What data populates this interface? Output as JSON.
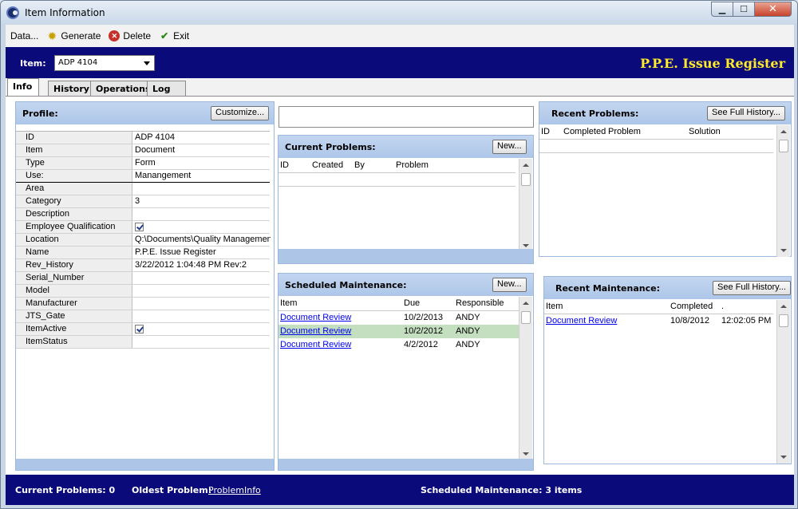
{
  "window": {
    "title": "Item Information"
  },
  "menu": {
    "data": "Data...",
    "generate": "Generate",
    "delete": "Delete",
    "exit": "Exit"
  },
  "header": {
    "item_label": "Item:",
    "item_value": "ADP 4104",
    "app_title": "P.P.E. Issue Register"
  },
  "tabs": [
    "Info",
    "History",
    "Operations",
    "Log"
  ],
  "profile": {
    "title": "Profile:",
    "customize": "Customize...",
    "rows": [
      {
        "k": "ID",
        "v": "ADP 4104"
      },
      {
        "k": "Item",
        "v": "Document"
      },
      {
        "k": "Type",
        "v": "Form"
      },
      {
        "k": "Use:",
        "v": "Manangement"
      },
      {
        "k": "Area",
        "v": ""
      },
      {
        "k": "Category",
        "v": "3"
      },
      {
        "k": "Description",
        "v": ""
      },
      {
        "k": "Employee Qualification",
        "v": "checked"
      },
      {
        "k": "Location",
        "v": "Q:\\Documents\\Quality Managemen"
      },
      {
        "k": "Name",
        "v": "P.P.E. Issue Register"
      },
      {
        "k": "Rev_History",
        "v": "3/22/2012 1:04:48 PM Rev:2"
      },
      {
        "k": "Serial_Number",
        "v": ""
      },
      {
        "k": "Model",
        "v": ""
      },
      {
        "k": "Manufacturer",
        "v": ""
      },
      {
        "k": "JTS_Gate",
        "v": ""
      },
      {
        "k": "ItemActive",
        "v": "checked"
      },
      {
        "k": "ItemStatus",
        "v": ""
      }
    ]
  },
  "search": {
    "value": ""
  },
  "current_problems": {
    "title": "Current Problems:",
    "new": "New...",
    "cols": [
      "ID",
      "Created",
      "By",
      "Problem"
    ]
  },
  "scheduled": {
    "title": "Scheduled Maintenance:",
    "new": "New...",
    "cols": [
      "Item",
      "Due",
      "Responsible"
    ],
    "rows": [
      {
        "item": "Document Review",
        "due": "10/2/2013",
        "resp": "ANDY"
      },
      {
        "item": "Document Review",
        "due": "10/2/2012",
        "resp": "ANDY"
      },
      {
        "item": "Document Review",
        "due": "4/2/2012",
        "resp": "ANDY"
      }
    ],
    "highlight_color": "#c4dfc0"
  },
  "recent_problems": {
    "title": "Recent Problems:",
    "full": "See Full History...",
    "cols": [
      "ID",
      "Completed",
      "Problem",
      "Solution"
    ]
  },
  "recent_maintenance": {
    "title": "Recent Maintenance:",
    "full": "See Full History...",
    "cols": [
      "Item",
      "Completed",
      "."
    ],
    "rows": [
      {
        "item": "Document Review",
        "date": "10/8/2012",
        "time": "12:02:05 PM"
      }
    ]
  },
  "status": {
    "current": "Current Problems: 0",
    "oldest_label": "Oldest Problem:",
    "oldest_link": "ProblemInfo",
    "scheduled": "Scheduled Maintenance: 3 items"
  },
  "colors": {
    "band": "#0a0a7a",
    "title_yellow": "#ffea2a",
    "panel_head": "#adc6e8"
  }
}
